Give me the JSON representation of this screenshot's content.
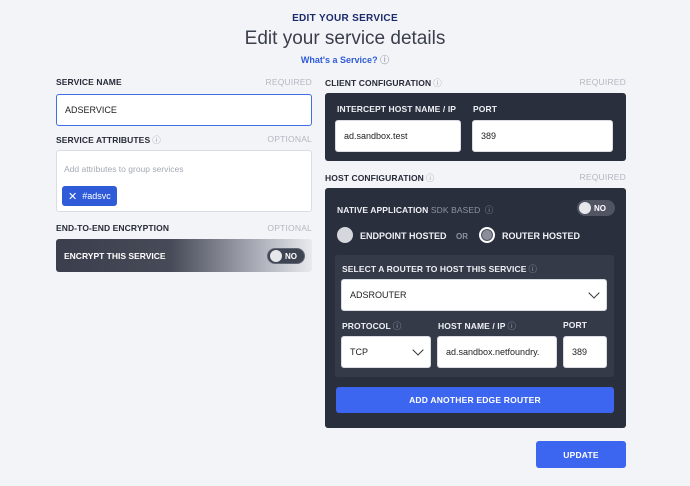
{
  "header": {
    "kicker": "EDIT YOUR SERVICE",
    "title": "Edit your service details",
    "help_link": "What's a Service?"
  },
  "service_name": {
    "label": "SERVICE NAME",
    "requirement": "REQUIRED",
    "value": "ADSERVICE"
  },
  "service_attributes": {
    "label": "SERVICE ATTRIBUTES",
    "requirement": "OPTIONAL",
    "placeholder": "Add attributes to group services",
    "tags": [
      "#adsvc"
    ]
  },
  "encryption": {
    "label": "END-TO-END ENCRYPTION",
    "requirement": "OPTIONAL",
    "toggle_label": "ENCRYPT THIS SERVICE",
    "toggle_state": "NO"
  },
  "client_config": {
    "label": "CLIENT CONFIGURATION",
    "requirement": "REQUIRED",
    "intercept_label": "INTERCEPT HOST NAME / IP",
    "intercept_value": "ad.sandbox.test",
    "port_label": "PORT",
    "port_value": "389"
  },
  "host_config": {
    "label": "HOST CONFIGURATION",
    "requirement": "REQUIRED",
    "native_app_label": "NATIVE APPLICATION",
    "native_app_note": "SDK BASED",
    "native_app_state": "NO",
    "endpoint_hosted": "ENDPOINT HOSTED",
    "or_text": "OR",
    "router_hosted": "ROUTER HOSTED",
    "router_select_label": "SELECT A ROUTER TO HOST THIS SERVICE",
    "router_value": "ADSROUTER",
    "protocol_label": "PROTOCOL",
    "protocol_value": "TCP",
    "hostname_label": "HOST NAME / IP",
    "hostname_value": "ad.sandbox.netfoundry.",
    "port_label": "PORT",
    "port_value": "389",
    "add_router_button": "ADD ANOTHER EDGE ROUTER"
  },
  "update_button": "UPDATE",
  "colors": {
    "accent": "#3d66f0",
    "panel": "#2a2f3d",
    "background": "#f3f4f8"
  }
}
